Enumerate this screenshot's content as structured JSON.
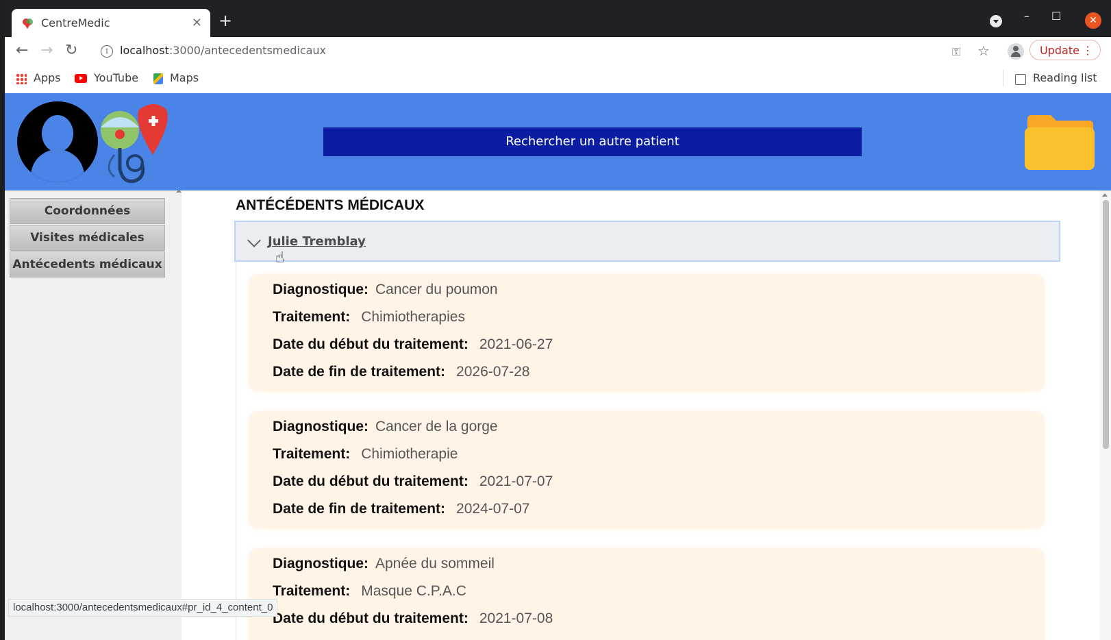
{
  "browser": {
    "tab_title": "CentreMedic",
    "tab_close": "×",
    "new_tab": "+",
    "url_host": "localhost",
    "url_path": ":3000/antecedentsmedicaux",
    "update_label": "Update",
    "update_menu": "⋮",
    "bookmarks": [
      {
        "label": "Apps",
        "icon": "apps-grid-icon"
      },
      {
        "label": "YouTube",
        "icon": "youtube-icon"
      },
      {
        "label": "Maps",
        "icon": "maps-icon"
      }
    ],
    "reading_list": "Reading list",
    "status_url": "localhost:3000/antecedentsmedicaux#pr_id_4_content_0"
  },
  "header": {
    "search_button": "Rechercher un autre patient",
    "colors": {
      "header_bg": "#4a84e6",
      "search_bg": "#0b1ea3",
      "folder": "#fbc02d"
    }
  },
  "sidebar": {
    "items": [
      {
        "label": "Coordonnées"
      },
      {
        "label": "Visites médicales"
      },
      {
        "label": "Antécedents médicaux"
      }
    ]
  },
  "main": {
    "title": "ANTÉCÉDENTS MÉDICAUX",
    "patient": "Julie Tremblay",
    "labels": {
      "diagnostic": "Diagnostique:",
      "treatment": "Traitement:",
      "start": "Date du début du traitement:",
      "end": "Date de fin de traitement:"
    },
    "records": [
      {
        "diagnostic": "Cancer du poumon",
        "treatment": "Chimiotherapies",
        "start": "2021-06-27",
        "end": "2026-07-28"
      },
      {
        "diagnostic": "Cancer de la gorge",
        "treatment": "Chimiotherapie",
        "start": "2021-07-07",
        "end": "2024-07-07"
      },
      {
        "diagnostic": "Apnée du sommeil",
        "treatment": "Masque C.P.A.C",
        "start": "2021-07-08",
        "end": ""
      }
    ]
  }
}
